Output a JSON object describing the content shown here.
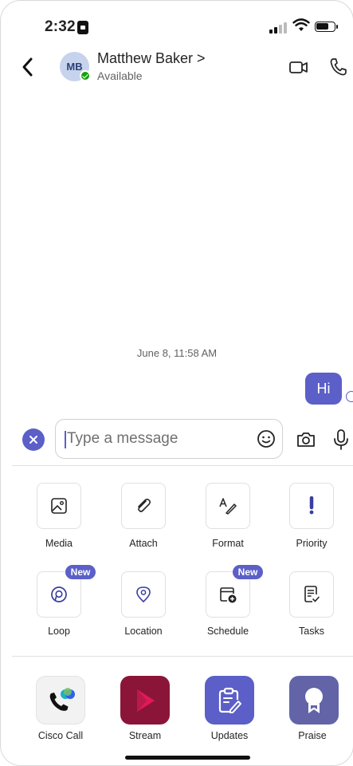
{
  "status_bar": {
    "time": "2:32"
  },
  "header": {
    "avatar_initials": "MB",
    "contact_name": "Matthew Baker >",
    "presence": "Available"
  },
  "conversation": {
    "timestamp": "June 8, 11:58 AM",
    "messages": [
      {
        "text": "Hi",
        "from": "me",
        "read": true
      }
    ]
  },
  "compose": {
    "placeholder": "Type a message"
  },
  "actions": [
    {
      "label": "Media",
      "icon": "image-icon"
    },
    {
      "label": "Attach",
      "icon": "paperclip-icon"
    },
    {
      "label": "Format",
      "icon": "format-pen-icon"
    },
    {
      "label": "Priority",
      "icon": "exclamation-icon"
    },
    {
      "label": "Loop",
      "icon": "loop-icon",
      "badge": "New"
    },
    {
      "label": "Location",
      "icon": "location-pin-icon"
    },
    {
      "label": "Schedule",
      "icon": "calendar-add-icon",
      "badge": "New"
    },
    {
      "label": "Tasks",
      "icon": "task-list-icon"
    }
  ],
  "apps": [
    {
      "label": "Cisco Call",
      "icon": "cisco-call-icon"
    },
    {
      "label": "Stream",
      "icon": "stream-play-icon"
    },
    {
      "label": "Updates",
      "icon": "clipboard-edit-icon"
    },
    {
      "label": "Praise",
      "icon": "badge-ribbon-icon"
    }
  ],
  "colors": {
    "accent": "#5b5fc7",
    "presence_available": "#13a10e",
    "stream": "#8b1538",
    "praise": "#6264a7"
  }
}
